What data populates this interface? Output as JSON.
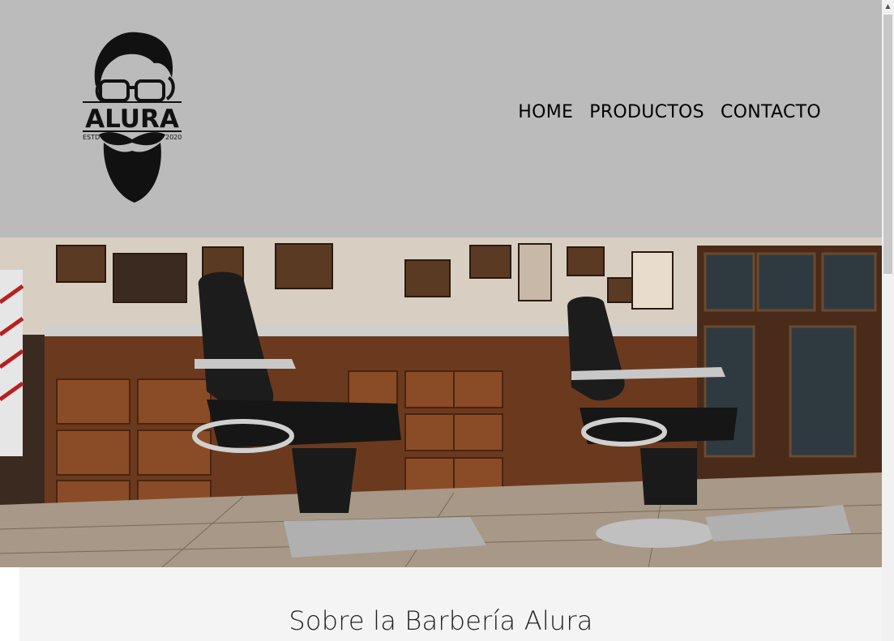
{
  "logo": {
    "text": "ALURA",
    "estd": "ESTD",
    "year": "2020"
  },
  "nav": {
    "items": [
      "HOME",
      "PRODUCTOS",
      "CONTACTO"
    ]
  },
  "hero": {
    "image": "barbershop-interior"
  },
  "about": {
    "title": "Sobre la Barbería Alura"
  },
  "colors": {
    "header_bg": "#bbbbbb",
    "text": "#000000"
  }
}
